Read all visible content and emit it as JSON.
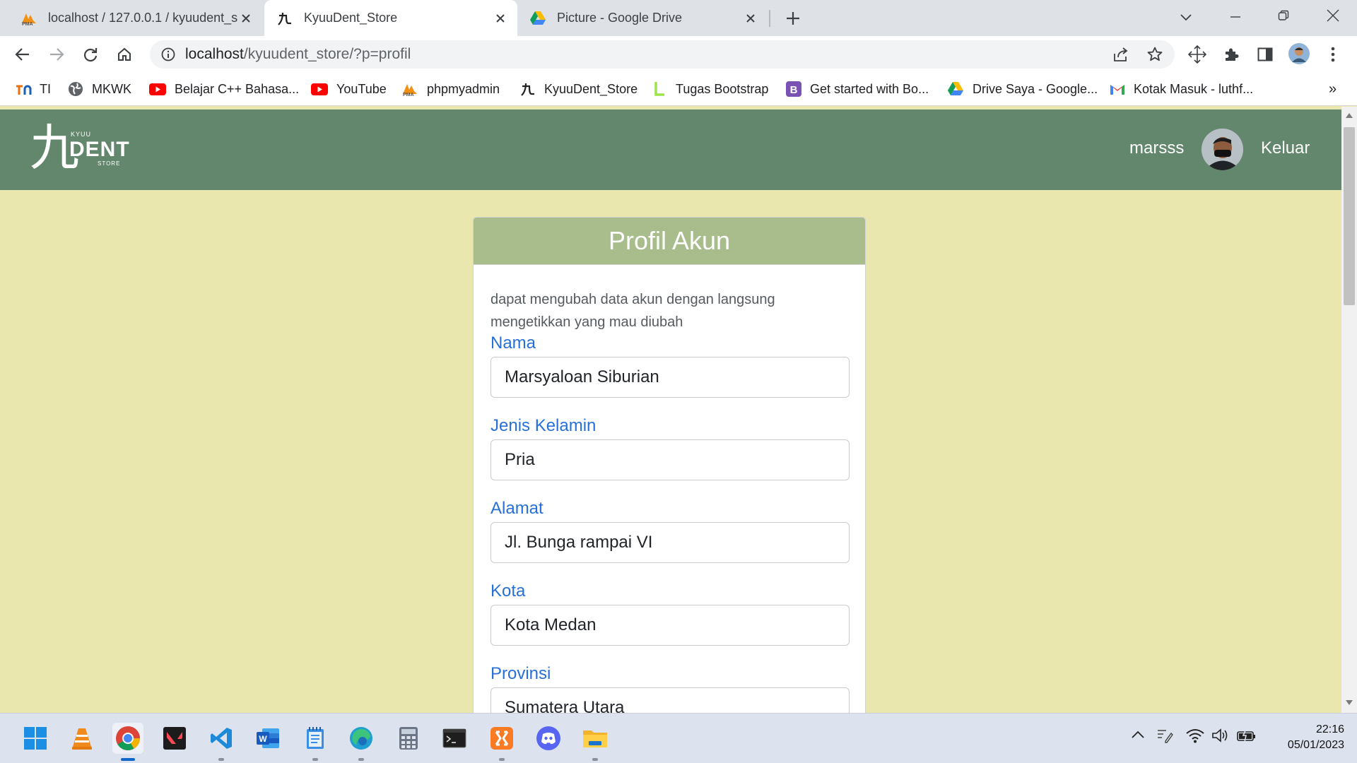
{
  "browser": {
    "tabs": [
      {
        "title": "localhost / 127.0.0.1 / kyuudent_s",
        "favicon": "phpmyadmin-icon",
        "active": false
      },
      {
        "title": "KyuuDent_Store",
        "favicon": "kyuu-logo-icon",
        "active": true
      },
      {
        "title": "Picture - Google Drive",
        "favicon": "google-drive-icon",
        "active": false
      }
    ],
    "address": {
      "host": "localhost",
      "path": "/kyuudent_store/?p=profil"
    },
    "bookmarks": [
      {
        "label": "TI",
        "icon": "ti-icon"
      },
      {
        "label": "MKWK",
        "icon": "globe-icon"
      },
      {
        "label": "Belajar C++ Bahasa...",
        "icon": "youtube-icon"
      },
      {
        "label": "YouTube",
        "icon": "youtube-icon"
      },
      {
        "label": "phpmyadmin",
        "icon": "phpmyadmin-icon"
      },
      {
        "label": "KyuuDent_Store",
        "icon": "kyuu-logo-icon"
      },
      {
        "label": "Tugas Bootstrap",
        "icon": "l-icon"
      },
      {
        "label": "Get started with Bo...",
        "icon": "bootstrap-icon"
      },
      {
        "label": "Drive Saya - Google...",
        "icon": "google-drive-icon"
      },
      {
        "label": "Kotak Masuk - luthf...",
        "icon": "gmail-icon"
      }
    ],
    "more_bookmarks": "»"
  },
  "site": {
    "logo": {
      "main": "DENT",
      "top": "KYUU",
      "bottom": "STORE",
      "glyph": "九"
    },
    "username": "marsss",
    "logout_label": "Keluar"
  },
  "profile": {
    "title": "Profil Akun",
    "note": "dapat mengubah data akun dengan langsung mengetikkan yang mau diubah",
    "fields": [
      {
        "label": "Nama",
        "value": "Marsyaloan Siburian"
      },
      {
        "label": "Jenis Kelamin",
        "value": "Pria"
      },
      {
        "label": "Alamat",
        "value": "Jl. Bunga rampai VI"
      },
      {
        "label": "Kota",
        "value": "Kota Medan"
      },
      {
        "label": "Provinsi",
        "value": "Sumatera Utara"
      }
    ]
  },
  "taskbar": {
    "apps": [
      "windows-start-icon",
      "vlc-icon",
      "chrome-icon",
      "valorant-icon",
      "vscode-icon",
      "word-icon",
      "notepad-icon",
      "edge-icon",
      "calculator-icon",
      "terminal-icon",
      "xampp-icon",
      "discord-icon",
      "file-explorer-icon"
    ],
    "time": "22:16",
    "date": "05/01/2023"
  },
  "colors": {
    "navbar": "#62876d",
    "page_bg": "#e9e6ae",
    "card_header": "#a8bc8c",
    "label_blue": "#2670d8"
  }
}
